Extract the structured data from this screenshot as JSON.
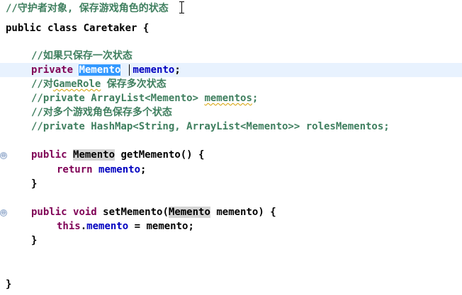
{
  "editor": {
    "lines": {
      "l1": {
        "comment": "//守护者对象, 保存游戏角色的状态"
      },
      "l2": {
        "kw_public": "public",
        "kw_class": "class",
        "name": "Caretaker",
        "brace": "{"
      },
      "l4": {
        "comment": "//如果只保存一次状态"
      },
      "l5": {
        "kw_private": "private",
        "type": "Memento",
        "field": "memento",
        "semi": ";"
      },
      "l6": {
        "comment_a": "//对",
        "comment_b": "GameRole",
        "comment_c": " 保存多次状态"
      },
      "l7": {
        "comment_a": "//private ArrayList<Memento> ",
        "comment_b": "mementos",
        "comment_c": ";"
      },
      "l8": {
        "comment": "//对多个游戏角色保存多个状态"
      },
      "l9": {
        "comment": "//private HashMap<String, ArrayList<Memento>> rolesMementos;"
      },
      "l11": {
        "kw_public": "public",
        "type": "Memento",
        "rest": "getMemento() {"
      },
      "l12": {
        "kw_return": "return",
        "field": "memento",
        "semi": ";"
      },
      "l13": {
        "brace": "}"
      },
      "l15": {
        "kw_public": "public",
        "kw_void": "void",
        "method": "setMemento(",
        "type": "Memento",
        "param": "memento) {"
      },
      "l16": {
        "kw_this": "this",
        "dot": ".",
        "field": "memento",
        "rest": " = memento;"
      },
      "l17": {
        "brace": "}"
      },
      "l20": {
        "brace": "}"
      }
    },
    "fold_markers": [
      "⊖",
      "⊖"
    ]
  }
}
